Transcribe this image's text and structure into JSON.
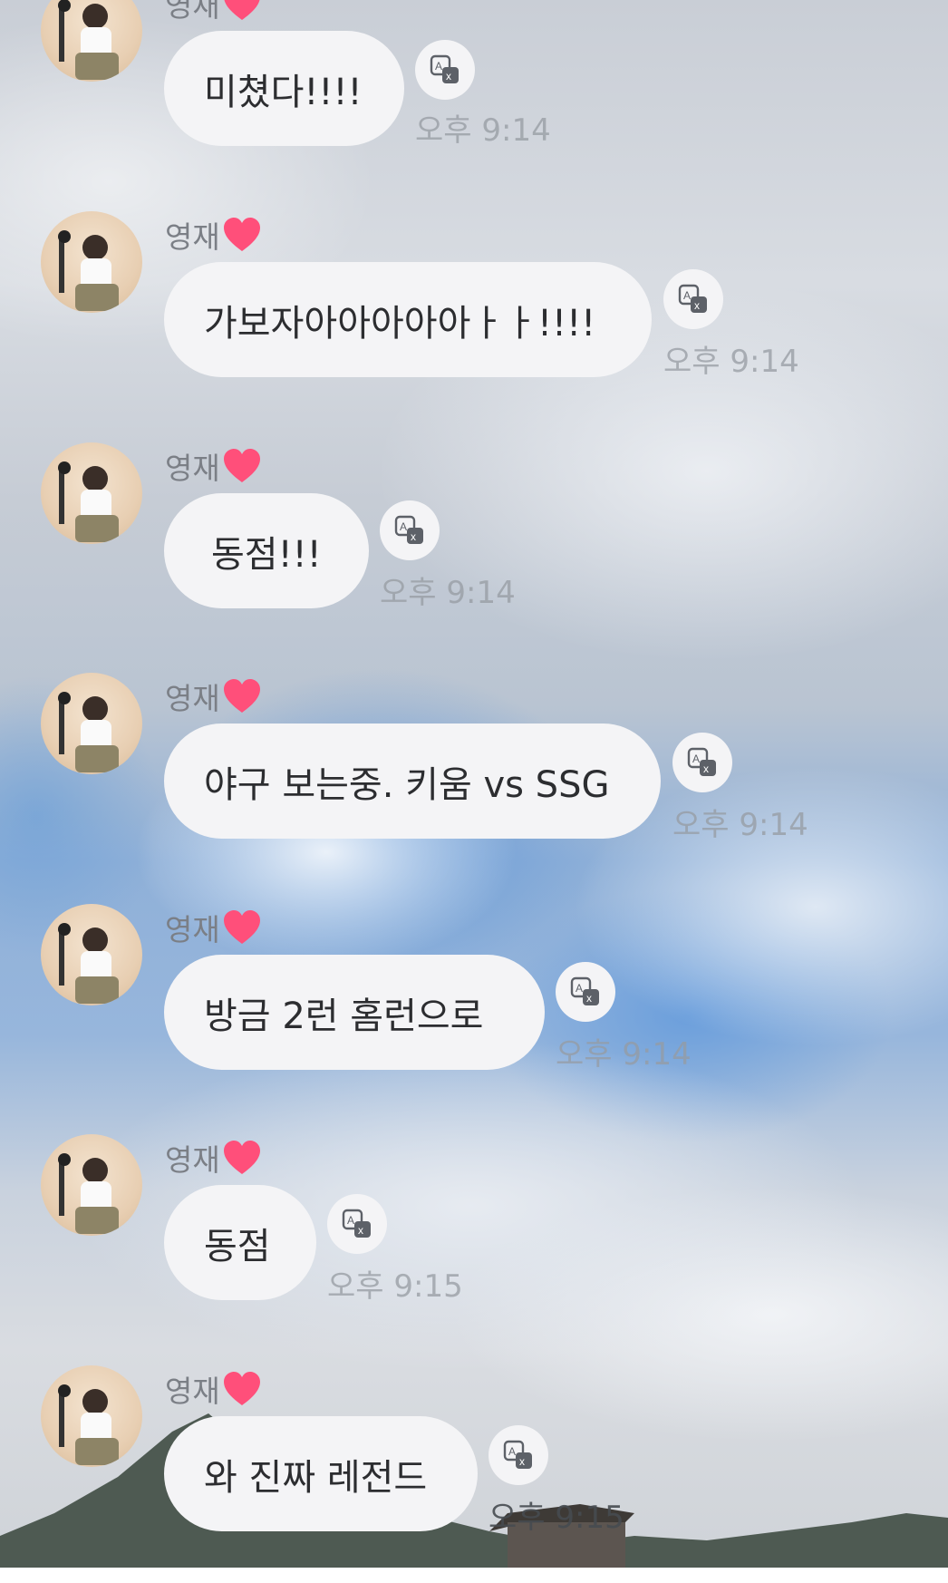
{
  "chat": {
    "messages": [
      {
        "sender": "영재",
        "text": "미쳤다!!!!",
        "time": "오후 9:14"
      },
      {
        "sender": "영재",
        "text": "가보자아아아아아ㅏㅏ!!!!",
        "time": "오후 9:14"
      },
      {
        "sender": "영재",
        "text": "동점!!!",
        "time": "오후 9:14"
      },
      {
        "sender": "영재",
        "text": "야구 보는중. 키움 vs SSG",
        "time": "오후 9:14"
      },
      {
        "sender": "영재",
        "text": "방금 2런 홈런으로",
        "time": "오후 9:14"
      },
      {
        "sender": "영재",
        "text": "동점",
        "time": "오후 9:15"
      },
      {
        "sender": "영재",
        "text": "와 진짜 레전드",
        "time": "오후 9:15"
      }
    ]
  },
  "colors": {
    "bubble": "#f4f4f6",
    "heart": "#ff4f7a",
    "time": "#969ba2"
  },
  "icons": {
    "translate": "translate-icon",
    "heart": "heart-icon"
  }
}
